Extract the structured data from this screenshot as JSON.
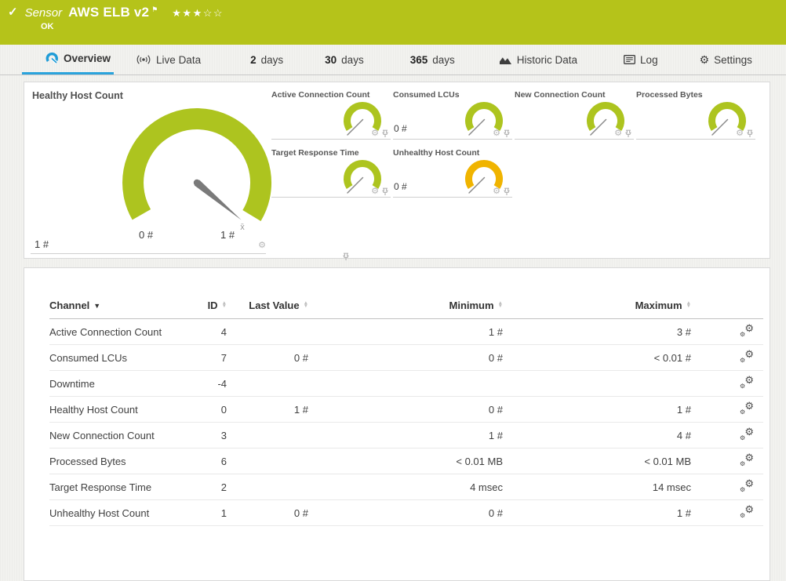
{
  "header": {
    "check_icon": "✓",
    "type_label": "Sensor",
    "title": "AWS ELB v2",
    "flag_icon": "⚑",
    "rating": {
      "filled": "★★★",
      "empty": "☆☆"
    },
    "status": "OK"
  },
  "tabs": {
    "overview": {
      "label": "Overview"
    },
    "live_data": {
      "label": "Live Data"
    },
    "days2": {
      "num": "2",
      "label": "days"
    },
    "days30": {
      "num": "30",
      "label": "days"
    },
    "days365": {
      "num": "365",
      "label": "days"
    },
    "historic": {
      "label": "Historic Data"
    },
    "log": {
      "label": "Log"
    },
    "settings": {
      "label": "Settings"
    }
  },
  "colors": {
    "header_green": "#b5c31a",
    "gauge_green": "#adc41f",
    "gauge_warning_yellow": "#f0b400",
    "tab_active_blue": "#2aa3dc",
    "needle_gray": "#7a7a7a"
  },
  "gauges": {
    "primary": {
      "title": "Healthy Host Count",
      "scale_min": "0 #",
      "scale_max": "1 #",
      "value": "1 #",
      "avg_marker": "x̄"
    },
    "small": [
      {
        "title": "Active Connection Count",
        "value": ""
      },
      {
        "title": "Consumed LCUs",
        "value": "0 #"
      },
      {
        "title": "New Connection Count",
        "value": ""
      },
      {
        "title": "Processed Bytes",
        "value": ""
      },
      {
        "title": "Target Response Time",
        "value": ""
      },
      {
        "title": "Unhealthy Host Count",
        "value": "0 #"
      }
    ]
  },
  "channel_table": {
    "columns": {
      "channel": "Channel",
      "id": "ID",
      "last_value": "Last Value",
      "minimum": "Minimum",
      "maximum": "Maximum"
    },
    "rows": [
      {
        "channel": "Active Connection Count",
        "id": "4",
        "last": "",
        "min": "1 #",
        "max": "3 #"
      },
      {
        "channel": "Consumed LCUs",
        "id": "7",
        "last": "0 #",
        "min": "0 #",
        "max": "< 0.01 #"
      },
      {
        "channel": "Downtime",
        "id": "-4",
        "last": "",
        "min": "",
        "max": ""
      },
      {
        "channel": "Healthy Host Count",
        "id": "0",
        "last": "1 #",
        "min": "0 #",
        "max": "1 #"
      },
      {
        "channel": "New Connection Count",
        "id": "3",
        "last": "",
        "min": "1 #",
        "max": "4 #"
      },
      {
        "channel": "Processed Bytes",
        "id": "6",
        "last": "",
        "min": "< 0.01 MB",
        "max": "< 0.01 MB"
      },
      {
        "channel": "Target Response Time",
        "id": "2",
        "last": "",
        "min": "4 msec",
        "max": "14 msec"
      },
      {
        "channel": "Unhealthy Host Count",
        "id": "1",
        "last": "0 #",
        "min": "0 #",
        "max": "1 #"
      }
    ]
  }
}
